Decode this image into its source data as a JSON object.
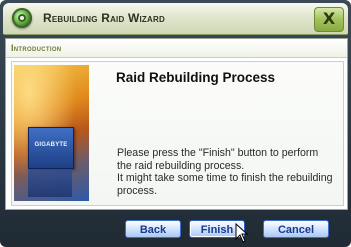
{
  "window": {
    "title": "Rebuilding Raid Wizard",
    "close_label": "X"
  },
  "section": {
    "label": "Introduction"
  },
  "content": {
    "heading": "Raid Rebuilding Process",
    "chip_label": "GIGABYTE",
    "body_lines": [
      "Please press the \"Finish\" button to perform",
      "the raid rebuilding process.",
      "It might take some time to finish the rebuilding",
      "process."
    ]
  },
  "buttons": {
    "back": "Back",
    "finish": "Finish",
    "cancel": "Cancel"
  }
}
